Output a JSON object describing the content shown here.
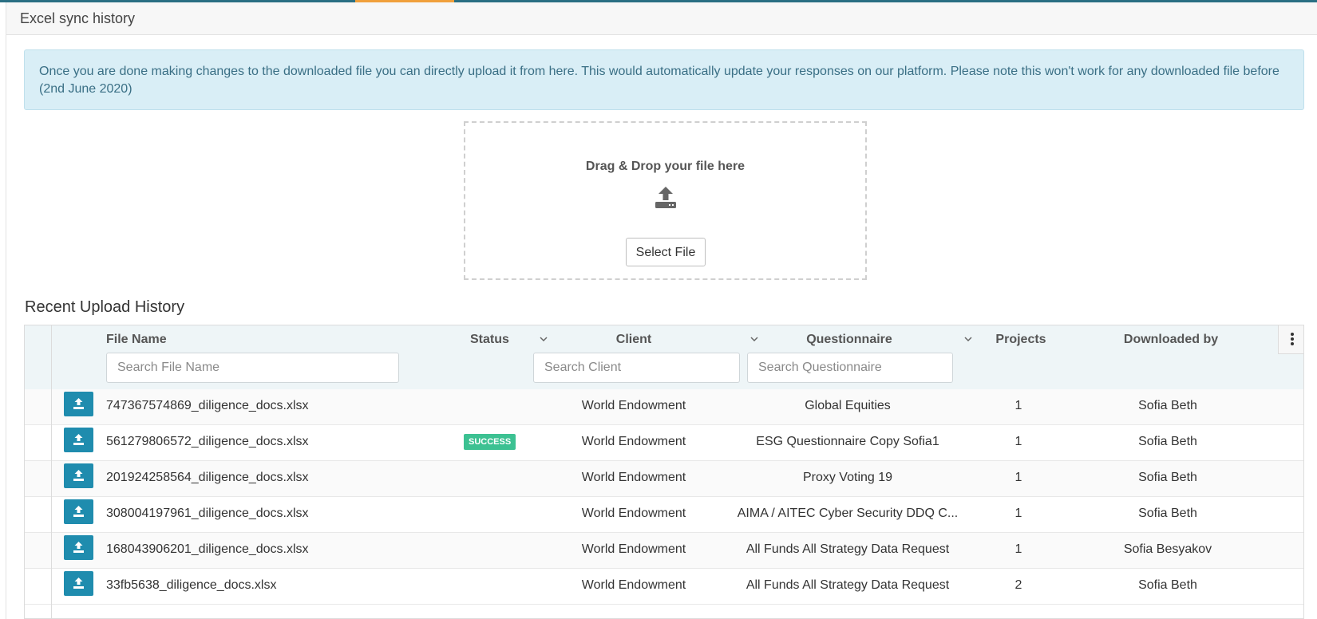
{
  "panel": {
    "title": "Excel sync history"
  },
  "info": {
    "text": "Once you are done making changes to the downloaded file you can directly upload it from here. This would automatically update your responses on our platform. Please note this won't work for any downloaded file before (2nd June 2020)"
  },
  "dropzone": {
    "title": "Drag & Drop your file here",
    "select_label": "Select File",
    "icon": "upload-tray-icon"
  },
  "history": {
    "title": "Recent Upload History",
    "columns": {
      "file_name": "File Name",
      "status": "Status",
      "client": "Client",
      "questionnaire": "Questionnaire",
      "projects": "Projects",
      "downloaded_by": "Downloaded by"
    },
    "search": {
      "file_name": "Search File Name",
      "client": "Search Client",
      "questionnaire": "Search Questionnaire"
    },
    "rows": [
      {
        "file": "747367574869_diligence_docs.xlsx",
        "status": "",
        "client": "World Endowment",
        "questionnaire": "Global Equities",
        "projects": "1",
        "downloaded_by": "Sofia Beth"
      },
      {
        "file": "561279806572_diligence_docs.xlsx",
        "status": "SUCCESS",
        "client": "World Endowment",
        "questionnaire": "ESG Questionnaire Copy Sofia1",
        "projects": "1",
        "downloaded_by": "Sofia Beth"
      },
      {
        "file": "201924258564_diligence_docs.xlsx",
        "status": "",
        "client": "World Endowment",
        "questionnaire": "Proxy Voting 19",
        "projects": "1",
        "downloaded_by": "Sofia Beth"
      },
      {
        "file": "308004197961_diligence_docs.xlsx",
        "status": "",
        "client": "World Endowment",
        "questionnaire": "AIMA / AITEC Cyber Security DDQ C...",
        "projects": "1",
        "downloaded_by": "Sofia Beth"
      },
      {
        "file": "168043906201_diligence_docs.xlsx",
        "status": "",
        "client": "World Endowment",
        "questionnaire": "All Funds All Strategy Data Request",
        "projects": "1",
        "downloaded_by": "Sofia Besyakov"
      },
      {
        "file": "33fb5638_diligence_docs.xlsx",
        "status": "",
        "client": "World Endowment",
        "questionnaire": "All Funds All Strategy Data Request",
        "projects": "2",
        "downloaded_by": "Sofia Beth"
      }
    ]
  },
  "colors": {
    "accent": "#1f8cae",
    "success": "#3cc192",
    "info_bg": "#d9eef6",
    "top_bar": "#2a6f83",
    "tab_accent": "#f0a03c"
  }
}
